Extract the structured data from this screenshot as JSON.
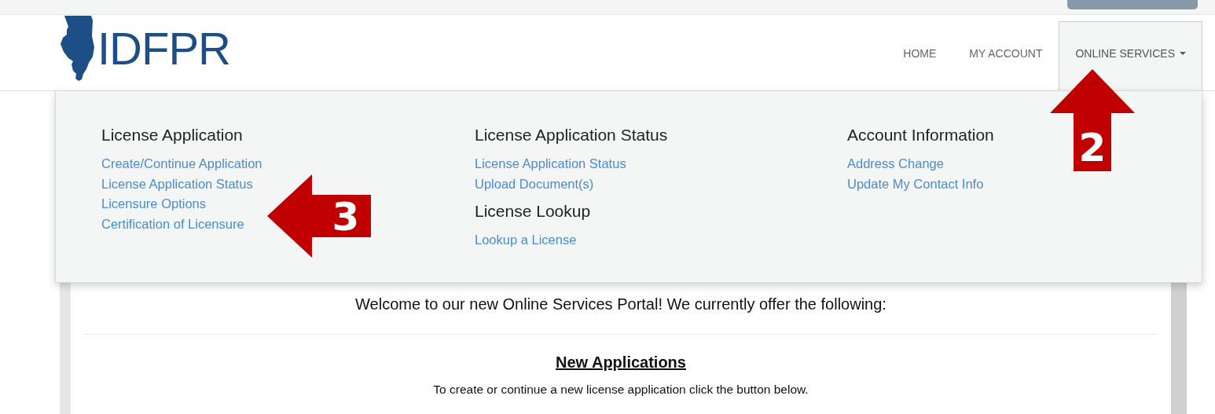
{
  "logo": {
    "text": "IDFPR"
  },
  "nav": [
    {
      "label": "HOME",
      "selected": false,
      "dropdown": false
    },
    {
      "label": "MY ACCOUNT",
      "selected": false,
      "dropdown": false
    },
    {
      "label": "ONLINE SERVICES",
      "selected": true,
      "dropdown": true
    }
  ],
  "menu": {
    "columns": [
      {
        "sections": [
          {
            "heading": "License Application",
            "links": [
              "Create/Continue Application",
              "License Application Status",
              "Licensure Options",
              "Certification of Licensure"
            ]
          }
        ]
      },
      {
        "sections": [
          {
            "heading": "License Application Status",
            "links": [
              "License Application Status",
              "Upload Document(s)"
            ]
          },
          {
            "heading": "License Lookup",
            "links": [
              "Lookup a License"
            ]
          }
        ]
      },
      {
        "sections": [
          {
            "heading": "Account Information",
            "links": [
              "Address Change",
              "Update My Contact Info"
            ]
          }
        ]
      }
    ]
  },
  "content": {
    "welcome": "Welcome to our new Online Services Portal! We currently offer the following:",
    "section_title": "New Applications",
    "instruction": "To create or continue a new license application click the button below."
  },
  "callouts": [
    {
      "label": "2",
      "kind": "up"
    },
    {
      "label": "3",
      "kind": "left"
    }
  ]
}
